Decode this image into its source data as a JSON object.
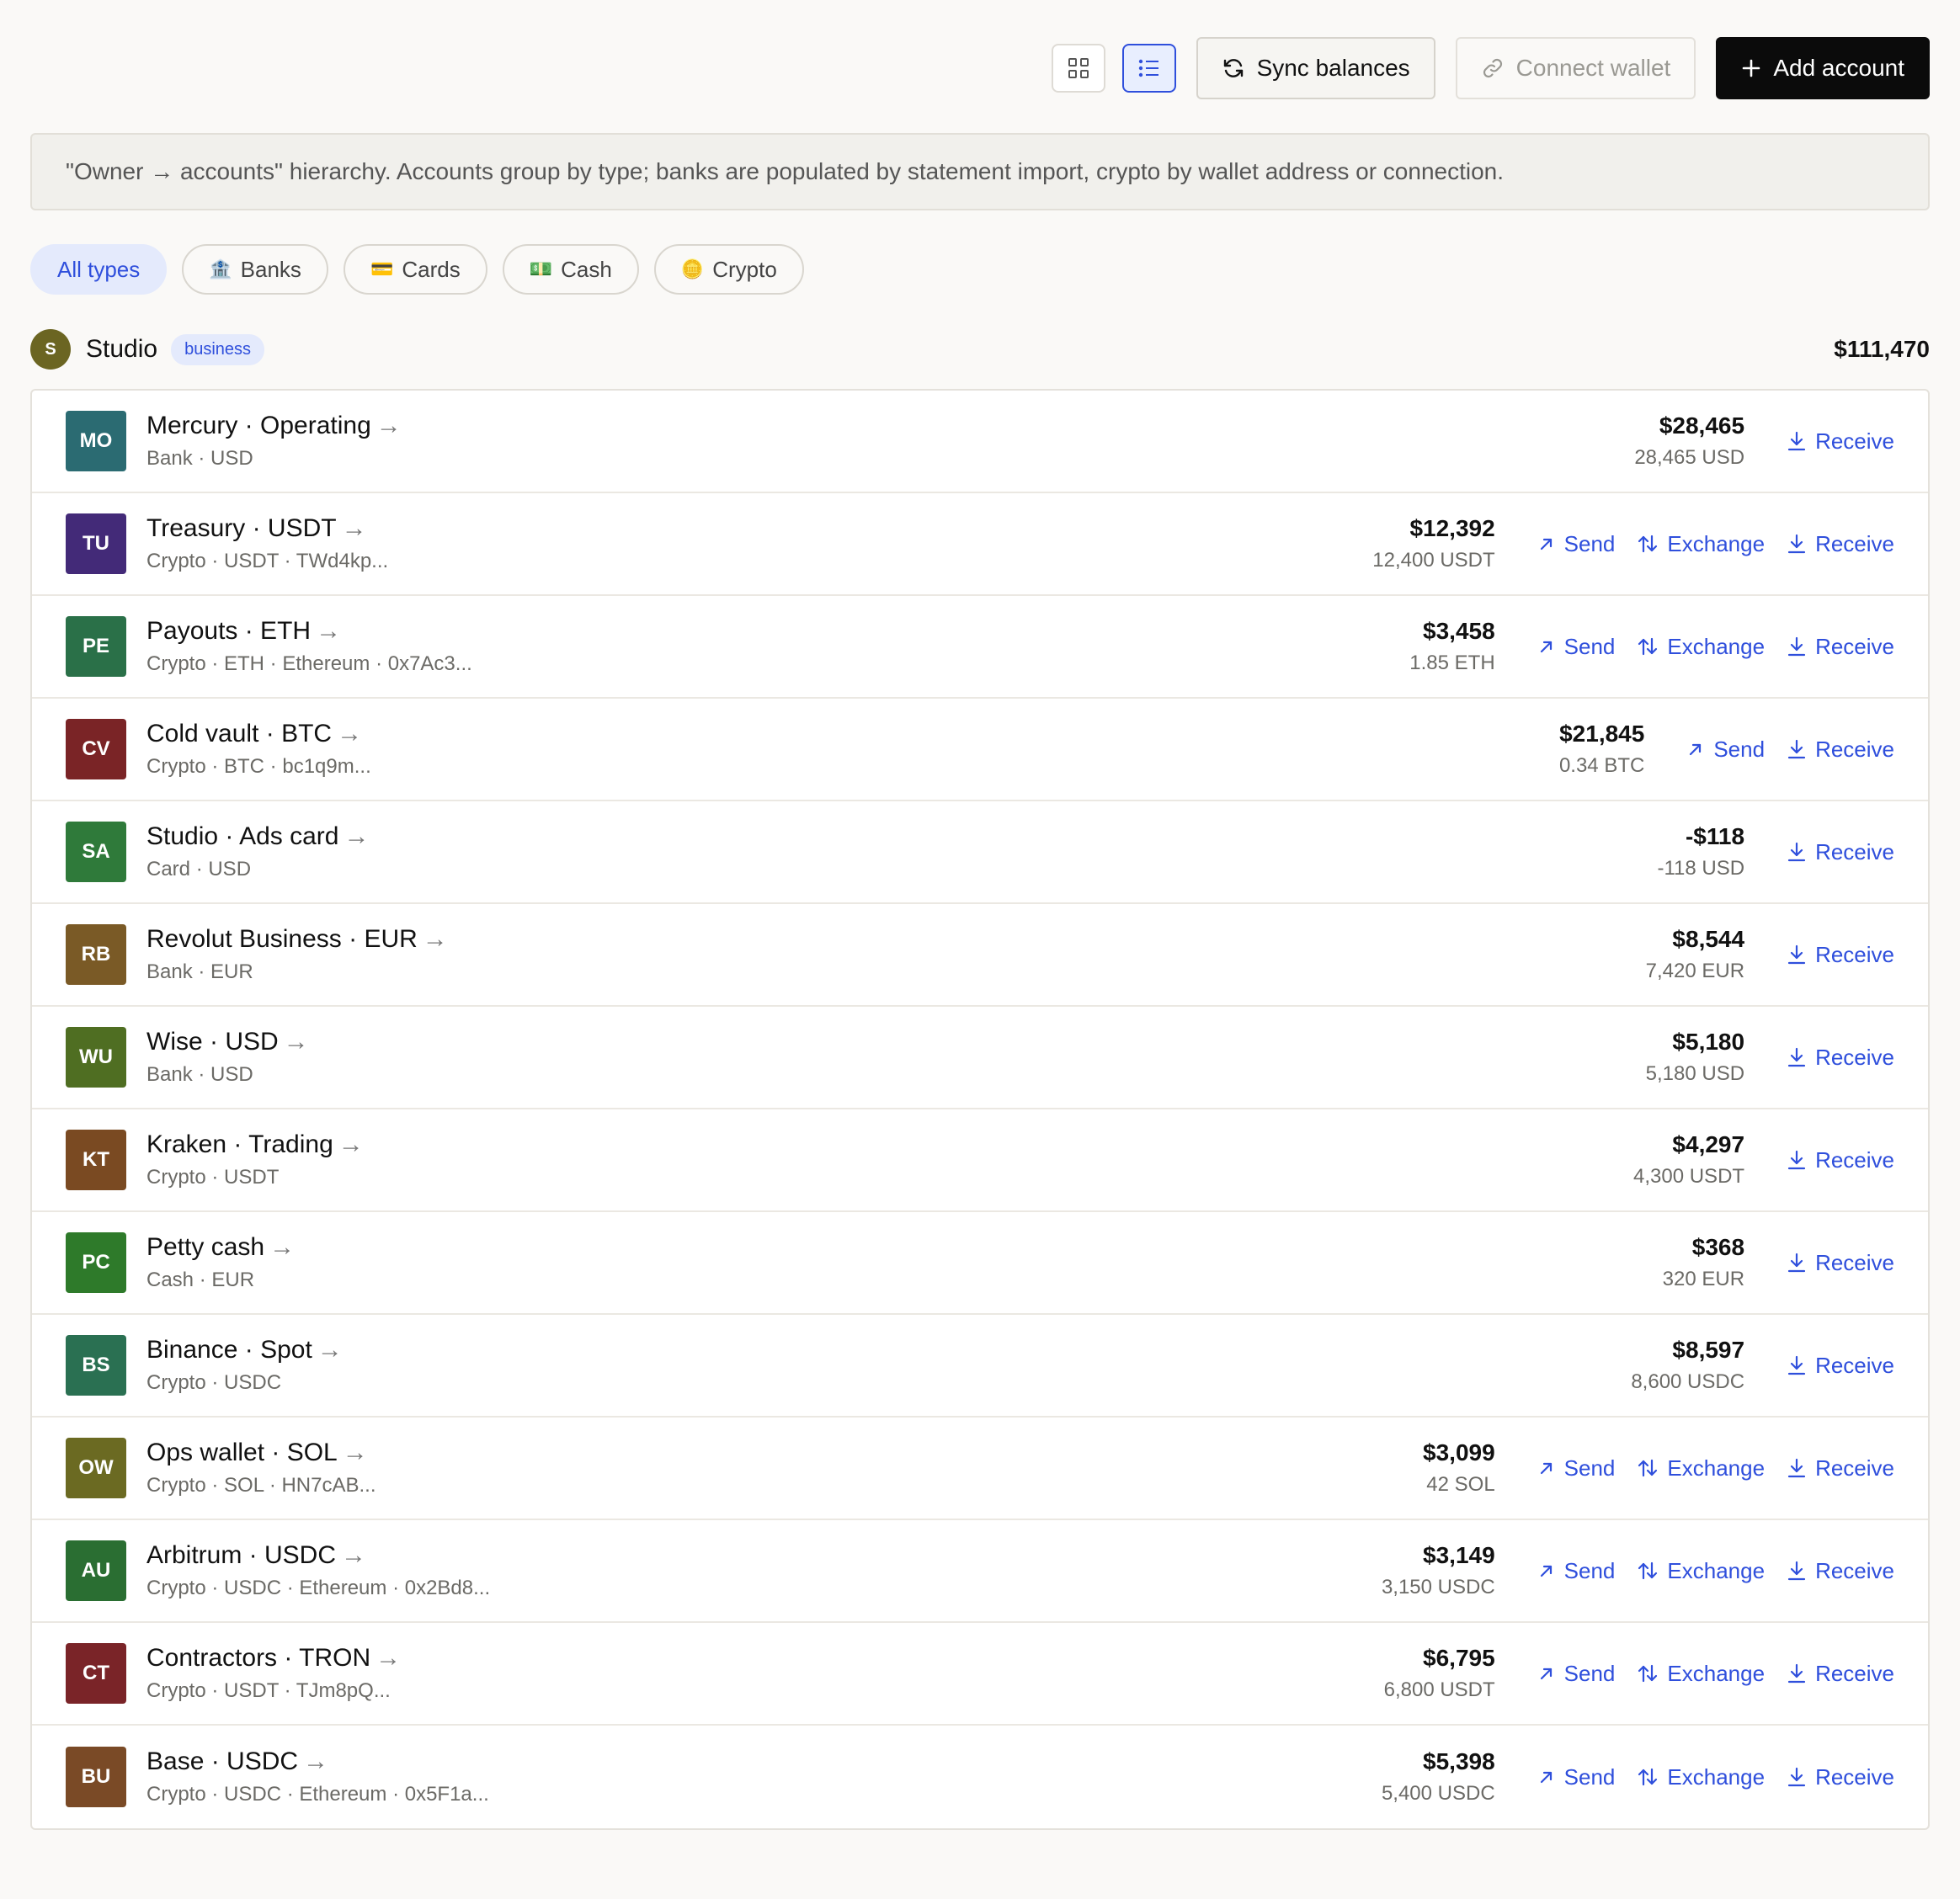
{
  "toolbar": {
    "sync_label": "Sync balances",
    "connect_label": "Connect wallet",
    "add_label": "Add account"
  },
  "banner": {
    "text": "\"Owner → accounts\" hierarchy. Accounts group by type; banks are populated by statement import, crypto by wallet address or connection."
  },
  "filters": [
    {
      "label": "All types",
      "icon": "",
      "active": true
    },
    {
      "label": "Banks",
      "icon": "🏦",
      "active": false
    },
    {
      "label": "Cards",
      "icon": "💳",
      "active": false
    },
    {
      "label": "Cash",
      "icon": "💵",
      "active": false
    },
    {
      "label": "Crypto",
      "icon": "🪙",
      "active": false
    }
  ],
  "owner": {
    "initial": "S",
    "name": "Studio",
    "badge": "business",
    "total": "$111,470"
  },
  "action_labels": {
    "send": "Send",
    "exchange": "Exchange",
    "receive": "Receive"
  },
  "colors": {
    "accent": "#2f4fdc",
    "primary_button": "#0b0b0b"
  },
  "accounts": [
    {
      "initials": "MO",
      "color": "#2b6b72",
      "name": "Mercury · Operating",
      "sub": "Bank · USD",
      "usd": "$28,465",
      "native": "28,465 USD",
      "actions": [
        "receive"
      ]
    },
    {
      "initials": "TU",
      "color": "#432a78",
      "name": "Treasury · USDT",
      "sub": "Crypto · USDT · TWd4kp...",
      "usd": "$12,392",
      "native": "12,400 USDT",
      "actions": [
        "send",
        "exchange",
        "receive"
      ]
    },
    {
      "initials": "PE",
      "color": "#2a7048",
      "name": "Payouts · ETH",
      "sub": "Crypto · ETH · Ethereum · 0x7Ac3...",
      "usd": "$3,458",
      "native": "1.85 ETH",
      "actions": [
        "send",
        "exchange",
        "receive"
      ]
    },
    {
      "initials": "CV",
      "color": "#7a2426",
      "name": "Cold vault · BTC",
      "sub": "Crypto · BTC · bc1q9m...",
      "usd": "$21,845",
      "native": "0.34 BTC",
      "actions": [
        "send",
        "receive"
      ]
    },
    {
      "initials": "SA",
      "color": "#2f7a3a",
      "name": "Studio · Ads card",
      "sub": "Card · USD",
      "usd": "-$118",
      "native": "-118 USD",
      "actions": [
        "receive"
      ]
    },
    {
      "initials": "RB",
      "color": "#7a5a26",
      "name": "Revolut Business · EUR",
      "sub": "Bank · EUR",
      "usd": "$8,544",
      "native": "7,420 EUR",
      "actions": [
        "receive"
      ]
    },
    {
      "initials": "WU",
      "color": "#4f6e22",
      "name": "Wise · USD",
      "sub": "Bank · USD",
      "usd": "$5,180",
      "native": "5,180 USD",
      "actions": [
        "receive"
      ]
    },
    {
      "initials": "KT",
      "color": "#7a4a22",
      "name": "Kraken · Trading",
      "sub": "Crypto · USDT",
      "usd": "$4,297",
      "native": "4,300 USDT",
      "actions": [
        "receive"
      ]
    },
    {
      "initials": "PC",
      "color": "#2e7a2a",
      "name": "Petty cash",
      "sub": "Cash · EUR",
      "usd": "$368",
      "native": "320 EUR",
      "actions": [
        "receive"
      ]
    },
    {
      "initials": "BS",
      "color": "#2a7052",
      "name": "Binance · Spot",
      "sub": "Crypto · USDC",
      "usd": "$8,597",
      "native": "8,600 USDC",
      "actions": [
        "receive"
      ]
    },
    {
      "initials": "OW",
      "color": "#6b6a22",
      "name": "Ops wallet · SOL",
      "sub": "Crypto · SOL · HN7cAB...",
      "usd": "$3,099",
      "native": "42 SOL",
      "actions": [
        "send",
        "exchange",
        "receive"
      ]
    },
    {
      "initials": "AU",
      "color": "#2a6e32",
      "name": "Arbitrum · USDC",
      "sub": "Crypto · USDC · Ethereum · 0x2Bd8...",
      "usd": "$3,149",
      "native": "3,150 USDC",
      "actions": [
        "send",
        "exchange",
        "receive"
      ]
    },
    {
      "initials": "CT",
      "color": "#7a2428",
      "name": "Contractors · TRON",
      "sub": "Crypto · USDT · TJm8pQ...",
      "usd": "$6,795",
      "native": "6,800 USDT",
      "actions": [
        "send",
        "exchange",
        "receive"
      ]
    },
    {
      "initials": "BU",
      "color": "#7a4a26",
      "name": "Base · USDC",
      "sub": "Crypto · USDC · Ethereum · 0x5F1a...",
      "usd": "$5,398",
      "native": "5,400 USDC",
      "actions": [
        "send",
        "exchange",
        "receive"
      ]
    }
  ]
}
